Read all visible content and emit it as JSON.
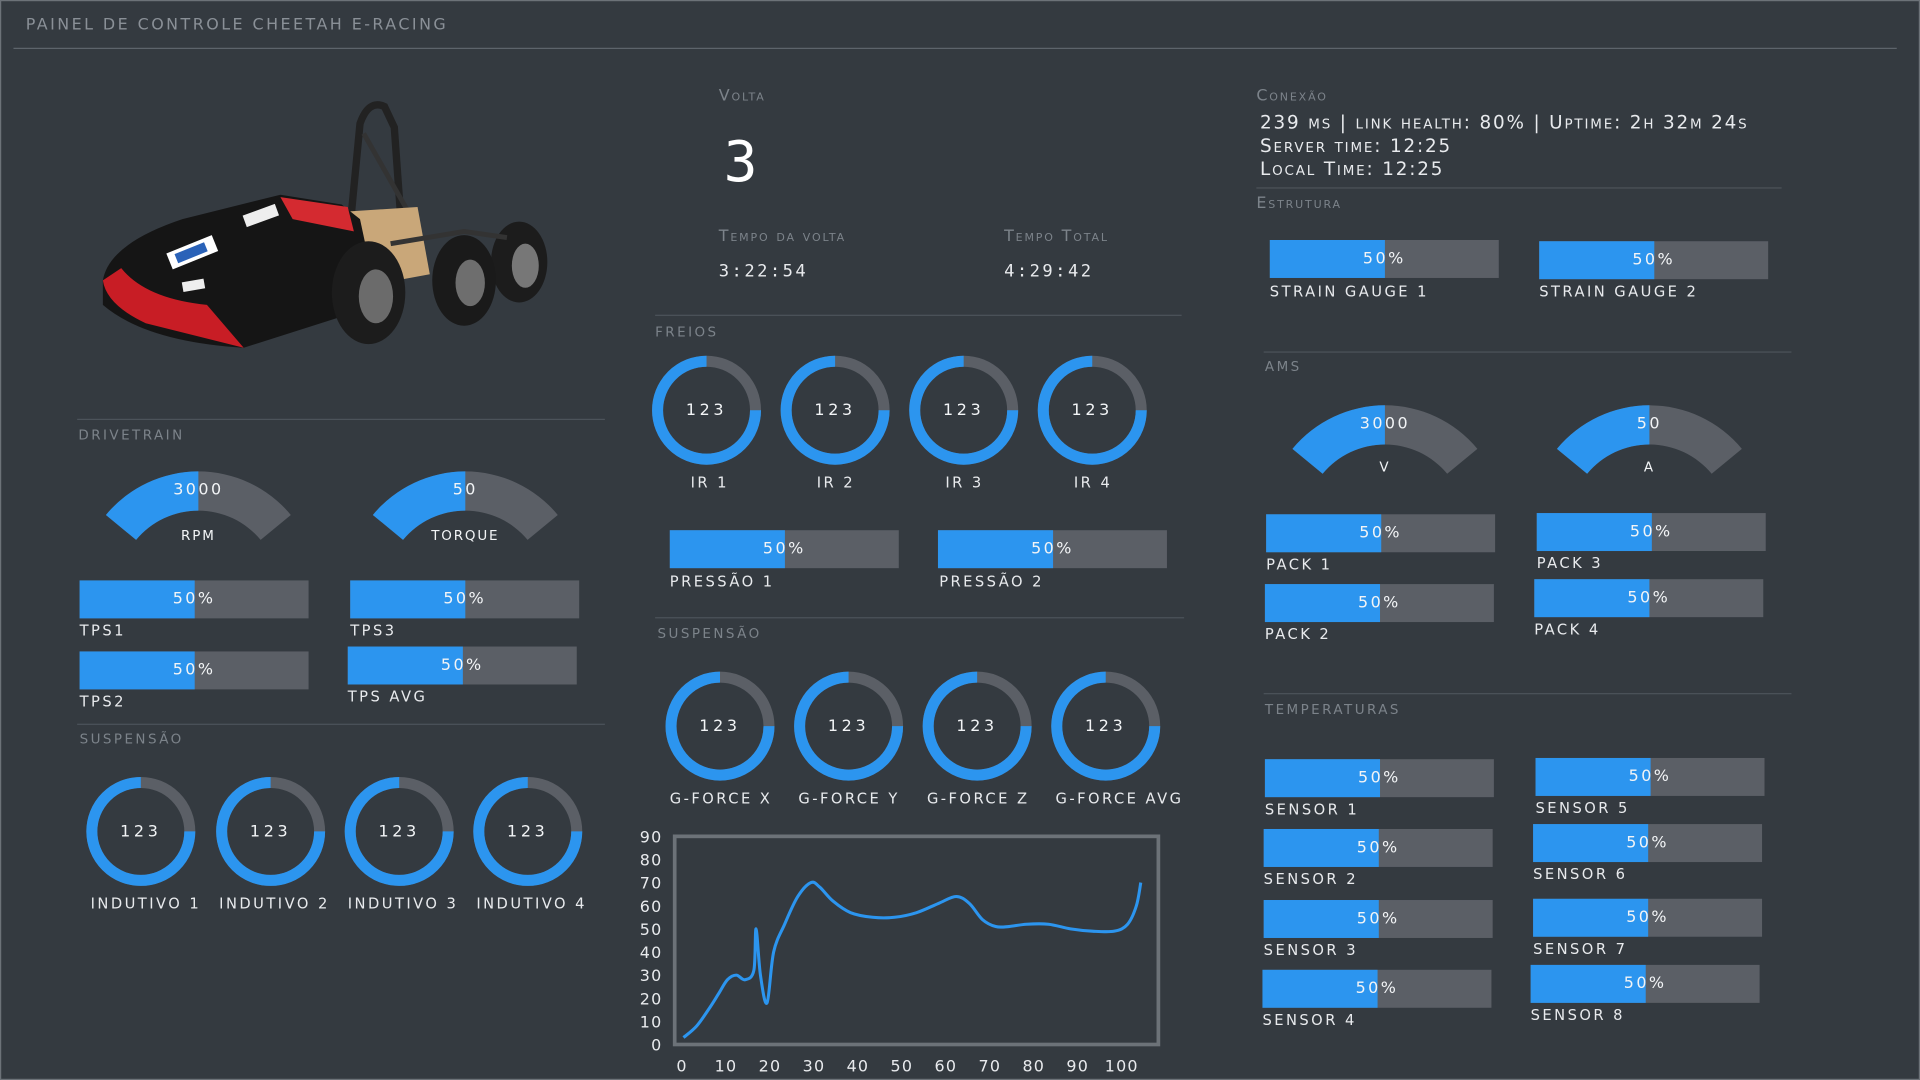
{
  "app": {
    "title": "PAINEL DE CONTROLE CHEETAH E-RACING"
  },
  "colors": {
    "accent": "#2c95ef",
    "track": "#5b5f66",
    "bg": "#343a40"
  },
  "car_image": {
    "icon": "race-car-image"
  },
  "drivetrain": {
    "title": "DRIVETRAIN",
    "gauges": [
      {
        "value": "3000",
        "unit": "RPM",
        "level": 0.5
      },
      {
        "value": "50",
        "unit": "TORQUE",
        "level": 0.5
      }
    ],
    "bars": [
      {
        "label": "TPS1",
        "text": "50%",
        "level": 0.5
      },
      {
        "label": "TPS3",
        "text": "50%",
        "level": 0.5
      },
      {
        "label": "TPS2",
        "text": "50%",
        "level": 0.5
      },
      {
        "label": "TPS AVG",
        "text": "50%",
        "level": 0.5
      }
    ]
  },
  "suspensao_left": {
    "title": "SUSPENSÃO",
    "rings": [
      {
        "value": "123",
        "label": "INDUTIVO 1",
        "level": 0.75
      },
      {
        "value": "123",
        "label": "INDUTIVO 2",
        "level": 0.75
      },
      {
        "value": "123",
        "label": "INDUTIVO 3",
        "level": 0.75
      },
      {
        "value": "123",
        "label": "INDUTIVO 4",
        "level": 0.75
      }
    ]
  },
  "volta": {
    "title": "Volta",
    "value": "3",
    "tempo_volta_label": "Tempo da volta",
    "tempo_volta": "3:22:54",
    "tempo_total_label": "Tempo Total",
    "tempo_total": "4:29:42"
  },
  "freios": {
    "title": "FREIOS",
    "rings": [
      {
        "value": "123",
        "label": "IR 1",
        "level": 0.75
      },
      {
        "value": "123",
        "label": "IR 2",
        "level": 0.75
      },
      {
        "value": "123",
        "label": "IR 3",
        "level": 0.75
      },
      {
        "value": "123",
        "label": "IR 4",
        "level": 0.75
      }
    ],
    "bars": [
      {
        "label": "PRESSÃO 1",
        "text": "50%",
        "level": 0.5
      },
      {
        "label": "PRESSÃO 2",
        "text": "50%",
        "level": 0.5
      }
    ]
  },
  "suspensao_center": {
    "title": "SUSPENSÃO",
    "rings": [
      {
        "value": "123",
        "label": "G-FORCE X",
        "level": 0.75
      },
      {
        "value": "123",
        "label": "G-FORCE Y",
        "level": 0.75
      },
      {
        "value": "123",
        "label": "G-FORCE Z",
        "level": 0.75
      },
      {
        "value": "123",
        "label": "G-FORCE AVG",
        "level": 0.75
      }
    ]
  },
  "chart_data": {
    "type": "line",
    "title": "",
    "xlabel": "",
    "ylabel": "",
    "xlim": [
      0,
      110
    ],
    "ylim": [
      0,
      90
    ],
    "x_ticks": [
      "0",
      "10",
      "20",
      "30",
      "40",
      "50",
      "60",
      "70",
      "80",
      "90",
      "100"
    ],
    "y_ticks": [
      "0",
      "10",
      "20",
      "30",
      "40",
      "50",
      "60",
      "70",
      "80",
      "90"
    ],
    "grid": false,
    "series": [
      {
        "color": "#2c95ef",
        "x": [
          2,
          5,
          8,
          10,
          12,
          14,
          16,
          18,
          18.5,
          19.5,
          21,
          22.5,
          25,
          28,
          31,
          33,
          36,
          40,
          45,
          50,
          55,
          60,
          64,
          67,
          70,
          73,
          76,
          80,
          85,
          90,
          95,
          100,
          103,
          105,
          106
        ],
        "y": [
          3,
          8,
          16,
          22,
          28,
          30,
          28,
          32,
          50,
          30,
          18,
          40,
          52,
          64,
          70,
          68,
          62,
          57,
          55,
          55,
          57,
          61,
          64,
          61,
          54,
          51,
          51,
          52,
          52,
          50,
          49,
          49,
          52,
          60,
          70
        ]
      }
    ]
  },
  "conexao": {
    "title": "Conexão",
    "line1": "239 ms | link health: 80% | Uptime: 2h 32m 24s",
    "line2": "Server time: 12:25",
    "line3": "Local Time: 12:25"
  },
  "estrutura": {
    "title": "Estrutura",
    "bars": [
      {
        "label": "STRAIN GAUGE 1",
        "text": "50%",
        "level": 0.5
      },
      {
        "label": "STRAIN GAUGE 2",
        "text": "50%",
        "level": 0.5
      }
    ]
  },
  "ams": {
    "title": "AMS",
    "gauges": [
      {
        "value": "3000",
        "unit": "V",
        "level": 0.5
      },
      {
        "value": "50",
        "unit": "A",
        "level": 0.5
      }
    ],
    "bars": [
      {
        "label": "PACK 1",
        "text": "50%",
        "level": 0.5
      },
      {
        "label": "PACK 3",
        "text": "50%",
        "level": 0.5
      },
      {
        "label": "PACK 2",
        "text": "50%",
        "level": 0.5
      },
      {
        "label": "PACK 4",
        "text": "50%",
        "level": 0.5
      }
    ]
  },
  "temperaturas": {
    "title": "TEMPERATURAS",
    "bars": [
      {
        "label": "SENSOR 1",
        "text": "50%",
        "level": 0.5
      },
      {
        "label": "SENSOR 5",
        "text": "50%",
        "level": 0.5
      },
      {
        "label": "SENSOR 2",
        "text": "50%",
        "level": 0.5
      },
      {
        "label": "SENSOR 6",
        "text": "50%",
        "level": 0.5
      },
      {
        "label": "SENSOR 3",
        "text": "50%",
        "level": 0.5
      },
      {
        "label": "SENSOR 7",
        "text": "50%",
        "level": 0.5
      },
      {
        "label": "SENSOR 4",
        "text": "50%",
        "level": 0.5
      },
      {
        "label": "SENSOR 8",
        "text": "50%",
        "level": 0.5
      }
    ]
  }
}
